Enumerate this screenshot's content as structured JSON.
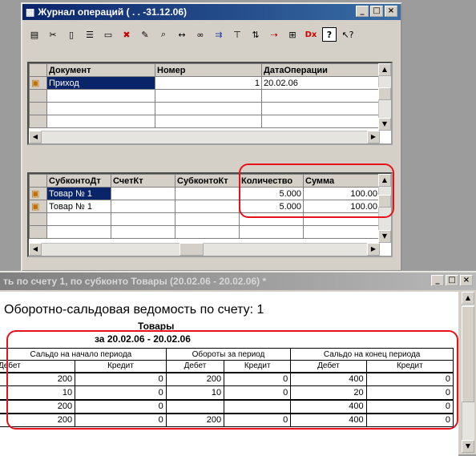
{
  "journal": {
    "title": "Журнал операций ( . . -31.12.06)",
    "toolbar_icons": [
      "new-icon",
      "copy-icon",
      "document-icon",
      "document-list-icon",
      "folder-icon",
      "delete-icon",
      "edit-icon",
      "find-icon",
      "binoculars-icon",
      "range-icon",
      "tree-icon",
      "filter-icon",
      "sort-icon",
      "move-icon",
      "tree-list-icon",
      "dx-icon",
      "help-icon",
      "help-pointer-icon"
    ],
    "documents": {
      "columns": [
        "Документ",
        "Номер",
        "ДатаОперации"
      ],
      "rows": [
        {
          "doc": "Приход",
          "num": "1",
          "date": "20.02.06"
        }
      ]
    },
    "entries": {
      "columns": [
        "СубконтоДт",
        "СчетКт",
        "СубконтоКт",
        "Количество",
        "Сумма"
      ],
      "rows": [
        {
          "sub_dt": "Товар № 1",
          "acc_kt": "",
          "sub_kt": "",
          "qty": "5.000",
          "sum": "100.00"
        },
        {
          "sub_dt": "Товар № 1",
          "acc_kt": "",
          "sub_kt": "",
          "qty": "5.000",
          "sum": "100.00"
        }
      ]
    }
  },
  "report_window": {
    "title": "ть по счету 1, по субконто Товары (20.02.06 - 20.02.06)  *",
    "heading": "Оборотно-сальдовая ведомость по счету: 1",
    "subheading": "Товары",
    "period": "за 20.02.06 - 20.02.06",
    "group_headers": [
      "Сальдо на начало периода",
      "Обороты за период",
      "Сальдо на конец периода"
    ],
    "sub_headers": [
      "Дебет",
      "Кредит",
      "Дебет",
      "Кредит",
      "Дебет",
      "Кредит"
    ],
    "rows": [
      [
        "200",
        "0",
        "200",
        "0",
        "400",
        "0"
      ],
      [
        "10",
        "0",
        "10",
        "0",
        "20",
        "0"
      ],
      [
        "200",
        "0",
        "",
        "",
        "400",
        "0"
      ],
      [
        "200",
        "0",
        "200",
        "0",
        "400",
        "0"
      ]
    ]
  },
  "colors": {
    "title_active": "#0a246a",
    "title_inactive": "#808080",
    "highlight": "#e8101a"
  }
}
